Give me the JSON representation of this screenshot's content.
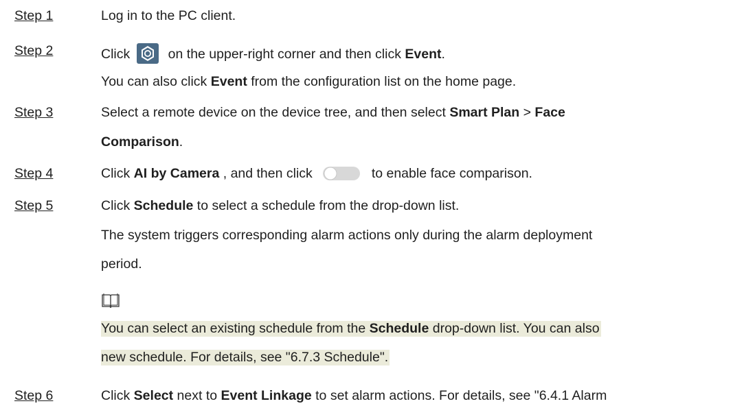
{
  "steps": [
    {
      "label": "Step 1",
      "text": "Log in to the PC client."
    },
    {
      "label": "Step 2",
      "pre": "Click",
      "post": " on the upper-right corner and then click ",
      "bold": "Event",
      "end": "."
    },
    {
      "label": "Step 3",
      "line1_pre": "Select a remote device on the device tree, and then select ",
      "bold1": "Smart Plan",
      "mid": " > ",
      "bold2": "Face",
      "line2_bold": "Comparison",
      "line2_end": "."
    },
    {
      "label": "Step 4",
      "pre": "Click ",
      "bold": "AI by Camera",
      "mid": " , and then click",
      "post": "to enable face comparison."
    },
    {
      "label": "Step 5",
      "pre": "Click ",
      "bold": "Schedule",
      "post": " to select a schedule from the drop-down list."
    },
    {
      "label": "Step 6",
      "pre": "Click ",
      "bold1": "Select",
      "mid": " next to ",
      "bold2": "Event Linkage",
      "post": " to set alarm actions. For details, see \"6.4.1 Alarm"
    }
  ],
  "step2_sub": {
    "pre": "You can also click ",
    "bold": "Event",
    "post": " from the configuration list on the home page."
  },
  "step5_sub": {
    "line1": "The system triggers corresponding alarm actions only during the alarm deployment",
    "line2": "period."
  },
  "note": {
    "icon": "book-icon",
    "line1_pre": "You can select an existing schedule from the ",
    "line1_bold": "Schedule",
    "line1_post": " drop-down list. You can also",
    "line2": "new schedule. For details, see \"6.7.3 Schedule\"."
  },
  "colors": {
    "settings_icon_bg": "#4a6a86",
    "note_highlight": "#ebebda",
    "toggle_track": "#d8d8d8"
  }
}
